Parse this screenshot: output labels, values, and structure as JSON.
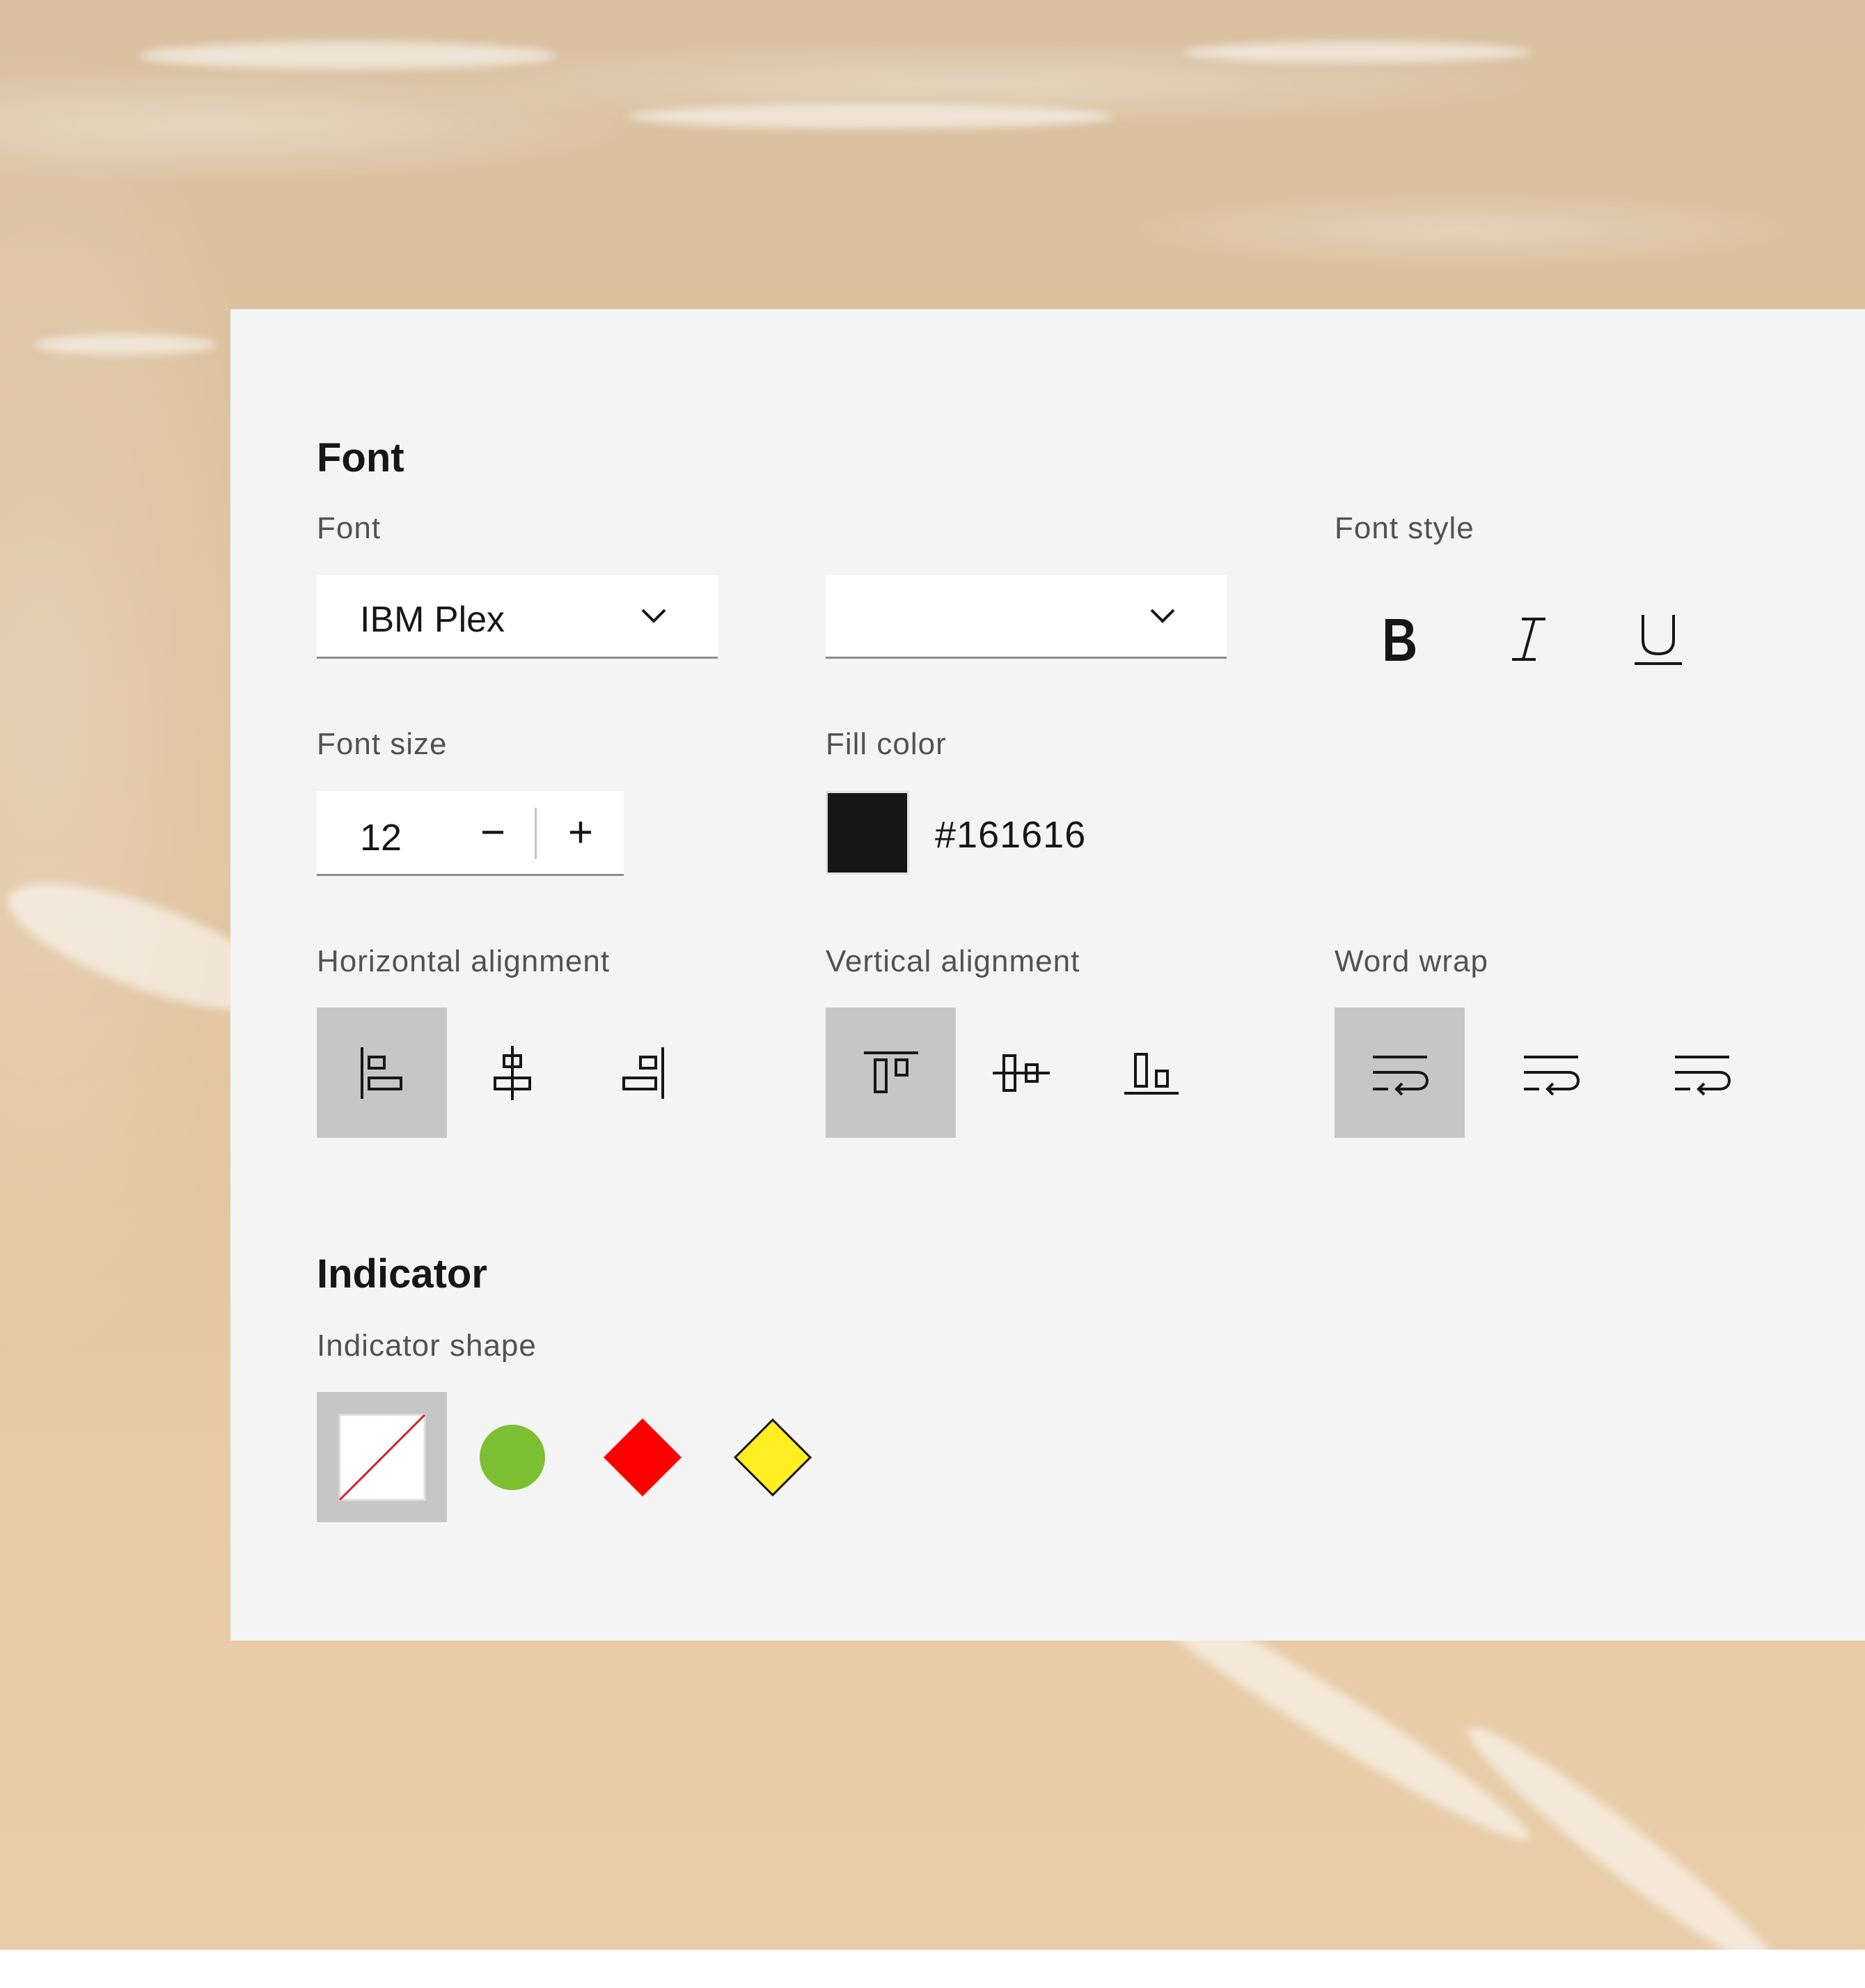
{
  "font_section": {
    "heading": "Font",
    "font_label": "Font",
    "font_family_value": "IBM Plex",
    "font_weight_value": "",
    "font_style_label": "Font style",
    "font_size_label": "Font size",
    "font_size_value": "12",
    "decrement_glyph": "−",
    "increment_glyph": "+",
    "fill_color_label": "Fill color",
    "fill_color_value": "#161616",
    "horizontal_alignment_label": "Horizontal alignment",
    "vertical_alignment_label": "Vertical alignment",
    "word_wrap_label": "Word wrap"
  },
  "indicator_section": {
    "heading": "Indicator",
    "shape_label": "Indicator shape"
  },
  "colors": {
    "panel_bg": "#f4f4f4",
    "selected_tile": "#c6c6c6",
    "fill_swatch": "#161616",
    "indicator_green": "#7cbf32",
    "indicator_red": "#ff0000",
    "indicator_yellow": "#ffee22"
  },
  "icons": {
    "bold": "bold-icon",
    "italic": "italic-icon",
    "underline": "underline-icon",
    "align_left": "align-left-icon",
    "align_center": "align-horizontal-center-icon",
    "align_right": "align-right-icon",
    "align_top": "align-top-icon",
    "align_middle": "align-vertical-center-icon",
    "align_bottom": "align-bottom-icon",
    "wrap": "text-wrap-icon"
  }
}
